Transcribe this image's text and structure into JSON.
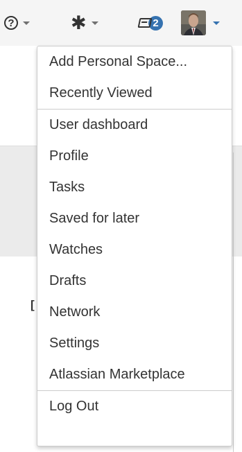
{
  "header": {
    "help_glyph": "?",
    "notifications_count": "2"
  },
  "menu": {
    "section1": [
      "Add Personal Space...",
      "Recently Viewed"
    ],
    "section2": [
      "User dashboard",
      "Profile",
      "Tasks",
      "Saved for later",
      "Watches",
      "Drafts",
      "Network",
      "Settings",
      "Atlassian Marketplace"
    ],
    "section3": [
      "Log Out"
    ]
  },
  "background": {
    "fragment": "["
  },
  "colors": {
    "accent": "#3572b0",
    "menu_text": "#333333",
    "border": "#cccccc",
    "header_bg": "#f5f5f5"
  }
}
